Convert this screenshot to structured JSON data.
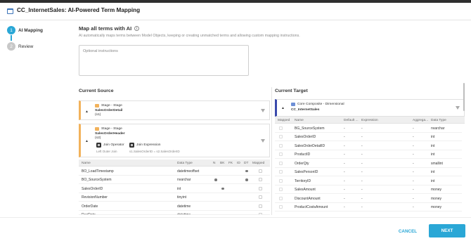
{
  "window": {
    "title": "CC_InternetSales: AI-Powered Term Mapping"
  },
  "steps": [
    {
      "number": "1",
      "label": "AI Mapping",
      "active": true
    },
    {
      "number": "2",
      "label": "Review",
      "active": false
    }
  ],
  "map_section": {
    "title": "Map all terms with AI",
    "info_icon": "info-icon",
    "description": "AI automatically maps terms between Model Objects, keeping or creating unmatched terms and allowing custom mapping instructions.",
    "instructions_placeholder": "Optional instructions",
    "instructions_value": ""
  },
  "source": {
    "title": "Current Source",
    "objects": [
      {
        "stage": "Stage - Stage",
        "name": "SalesOrderDetail",
        "alias": "(s1)"
      },
      {
        "stage": "Stage - Stage",
        "name": "SalesOrderHeader",
        "alias": "(s2)",
        "join_operator_label": "Join Operator",
        "join_operator_value": "Left Outer Join",
        "join_expression_label": "Join Expression",
        "join_expression_value": "s1.SalesOrderID = s2.SalesOrderID"
      }
    ],
    "columns": [
      "Name",
      "Data Type",
      "N",
      "BK",
      "FK",
      "ID",
      "DT",
      "Mapped"
    ],
    "rows": [
      {
        "name": "BO_LoadTimestamp",
        "type": "datetimeoffset",
        "bk": false,
        "fk": false,
        "dt": true
      },
      {
        "name": "BO_SourceSystem",
        "type": "nvarchar",
        "bk": true,
        "fk": false,
        "dt": true
      },
      {
        "name": "SalesOrderID",
        "type": "int",
        "bk": false,
        "fk": true,
        "dt": false
      },
      {
        "name": "RevisionNumber",
        "type": "tinyint",
        "bk": false,
        "fk": false,
        "dt": false
      },
      {
        "name": "OrderDate",
        "type": "datetime",
        "bk": false,
        "fk": false,
        "dt": false
      },
      {
        "name": "DueDate",
        "type": "datetime",
        "bk": false,
        "fk": false,
        "dt": false
      }
    ]
  },
  "target": {
    "title": "Current Target",
    "object": {
      "stage": "Core Composite - Dimensional",
      "name": "CC_InternetSales"
    },
    "columns": [
      "Mapped",
      "Name",
      "Default ...",
      "Expression",
      "Aggrega...",
      "Data Type"
    ],
    "rows": [
      {
        "name": "BG_SourceSystem",
        "default": "-",
        "expression": "-",
        "aggregation": "-",
        "type": "nvarchar"
      },
      {
        "name": "SalesOrderID",
        "default": "-",
        "expression": "-",
        "aggregation": "-",
        "type": "int"
      },
      {
        "name": "SalesOrderDetailID",
        "default": "-",
        "expression": "-",
        "aggregation": "-",
        "type": "int"
      },
      {
        "name": "ProductID",
        "default": "-",
        "expression": "-",
        "aggregation": "-",
        "type": "int"
      },
      {
        "name": "OrderQty",
        "default": "-",
        "expression": "-",
        "aggregation": "-",
        "type": "smallint"
      },
      {
        "name": "SalesPersonID",
        "default": "-",
        "expression": "-",
        "aggregation": "-",
        "type": "int"
      },
      {
        "name": "TerritoryID",
        "default": "-",
        "expression": "-",
        "aggregation": "-",
        "type": "int"
      },
      {
        "name": "SalesAmount",
        "default": "-",
        "expression": "-",
        "aggregation": "-",
        "type": "money"
      },
      {
        "name": "DiscountAmount",
        "default": "-",
        "expression": "-",
        "aggregation": "-",
        "type": "money"
      },
      {
        "name": "ProductCostsAmount",
        "default": "-",
        "expression": "-",
        "aggregation": "-",
        "type": "money"
      }
    ]
  },
  "footer": {
    "cancel_label": "CANCEL",
    "next_label": "NEXT"
  },
  "colors": {
    "accent": "#2aa7d6",
    "source_accent": "#f2b25b",
    "target_accent": "#3949ab"
  }
}
